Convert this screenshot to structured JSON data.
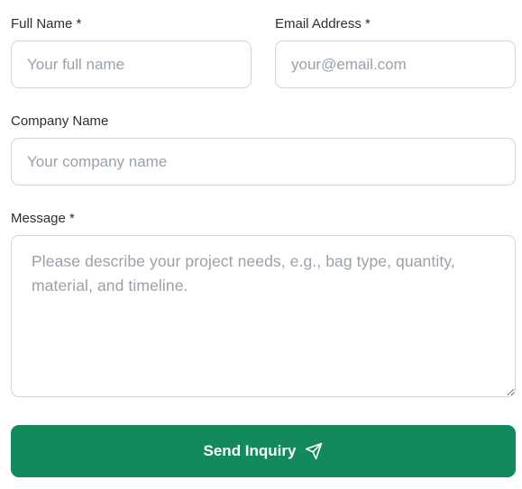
{
  "form": {
    "full_name": {
      "label": "Full Name *",
      "value": "",
      "placeholder": "Your full name"
    },
    "email": {
      "label": "Email Address *",
      "value": "",
      "placeholder": "your@email.com"
    },
    "company": {
      "label": "Company Name",
      "value": "",
      "placeholder": "Your company name"
    },
    "message": {
      "label": "Message *",
      "value": "",
      "placeholder": "Please describe your project needs, e.g., bag type, quantity, material, and timeline."
    },
    "submit": {
      "label": "Send Inquiry",
      "icon": "send-icon"
    }
  },
  "colors": {
    "accent": "#138a5c",
    "border": "#cfd5dc",
    "placeholder": "#9aa1ab"
  }
}
